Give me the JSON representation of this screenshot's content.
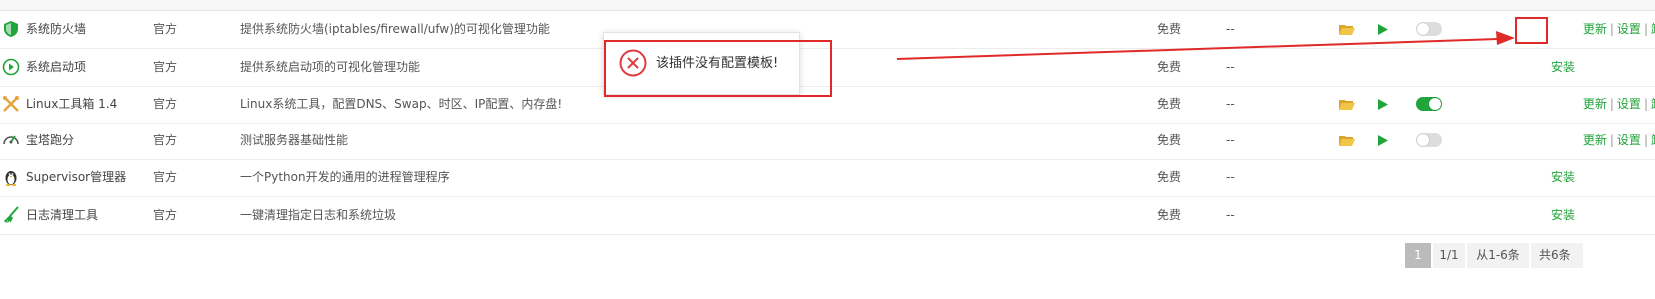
{
  "plugins": [
    {
      "name": "系统防火墙",
      "developer": "官方",
      "description": "提供系统防火墙(iptables/firewall/ufw)的可视化管理功能",
      "price": "免费",
      "expire": "--",
      "icon": "shield-icon",
      "has_folder": true,
      "has_play": true,
      "toggle": "off",
      "ops": [
        "更新",
        "设置",
        "卸载"
      ]
    },
    {
      "name": "系统启动项",
      "developer": "官方",
      "description": "提供系统启动项的可视化管理功能",
      "price": "免费",
      "expire": "--",
      "icon": "startup-icon",
      "has_folder": false,
      "has_play": false,
      "toggle": null,
      "ops": [
        "安装"
      ]
    },
    {
      "name": "Linux工具箱 1.4",
      "developer": "官方",
      "description": "Linux系统工具，配置DNS、Swap、时区、IP配置、内存盘!",
      "price": "免费",
      "expire": "--",
      "icon": "tools-icon",
      "has_folder": true,
      "has_play": true,
      "toggle": "on",
      "ops": [
        "更新",
        "设置",
        "卸载"
      ]
    },
    {
      "name": "宝塔跑分",
      "developer": "官方",
      "description": "测试服务器基础性能",
      "price": "免费",
      "expire": "--",
      "icon": "speedometer-icon",
      "has_folder": true,
      "has_play": true,
      "toggle": "off",
      "ops": [
        "更新",
        "设置",
        "卸载"
      ]
    },
    {
      "name": "Supervisor管理器",
      "developer": "官方",
      "description": "一个Python开发的通用的进程管理程序",
      "price": "免费",
      "expire": "--",
      "icon": "penguin-icon",
      "has_folder": false,
      "has_play": false,
      "toggle": null,
      "ops": [
        "安装"
      ]
    },
    {
      "name": "日志清理工具",
      "developer": "官方",
      "description": "一键清理指定日志和系统垃圾",
      "price": "免费",
      "expire": "--",
      "icon": "broom-icon",
      "has_folder": false,
      "has_play": false,
      "toggle": null,
      "ops": [
        "安装"
      ]
    }
  ],
  "pagination": {
    "current": "1",
    "pages": "1/1",
    "range": "从1-6条",
    "total": "共6条"
  },
  "toast": {
    "message": "该插件没有配置模板!",
    "icon": "error-circle-icon"
  },
  "colors": {
    "accent": "#20a53a",
    "annotation": "#e02a2a",
    "folder": "#e8b93b"
  }
}
